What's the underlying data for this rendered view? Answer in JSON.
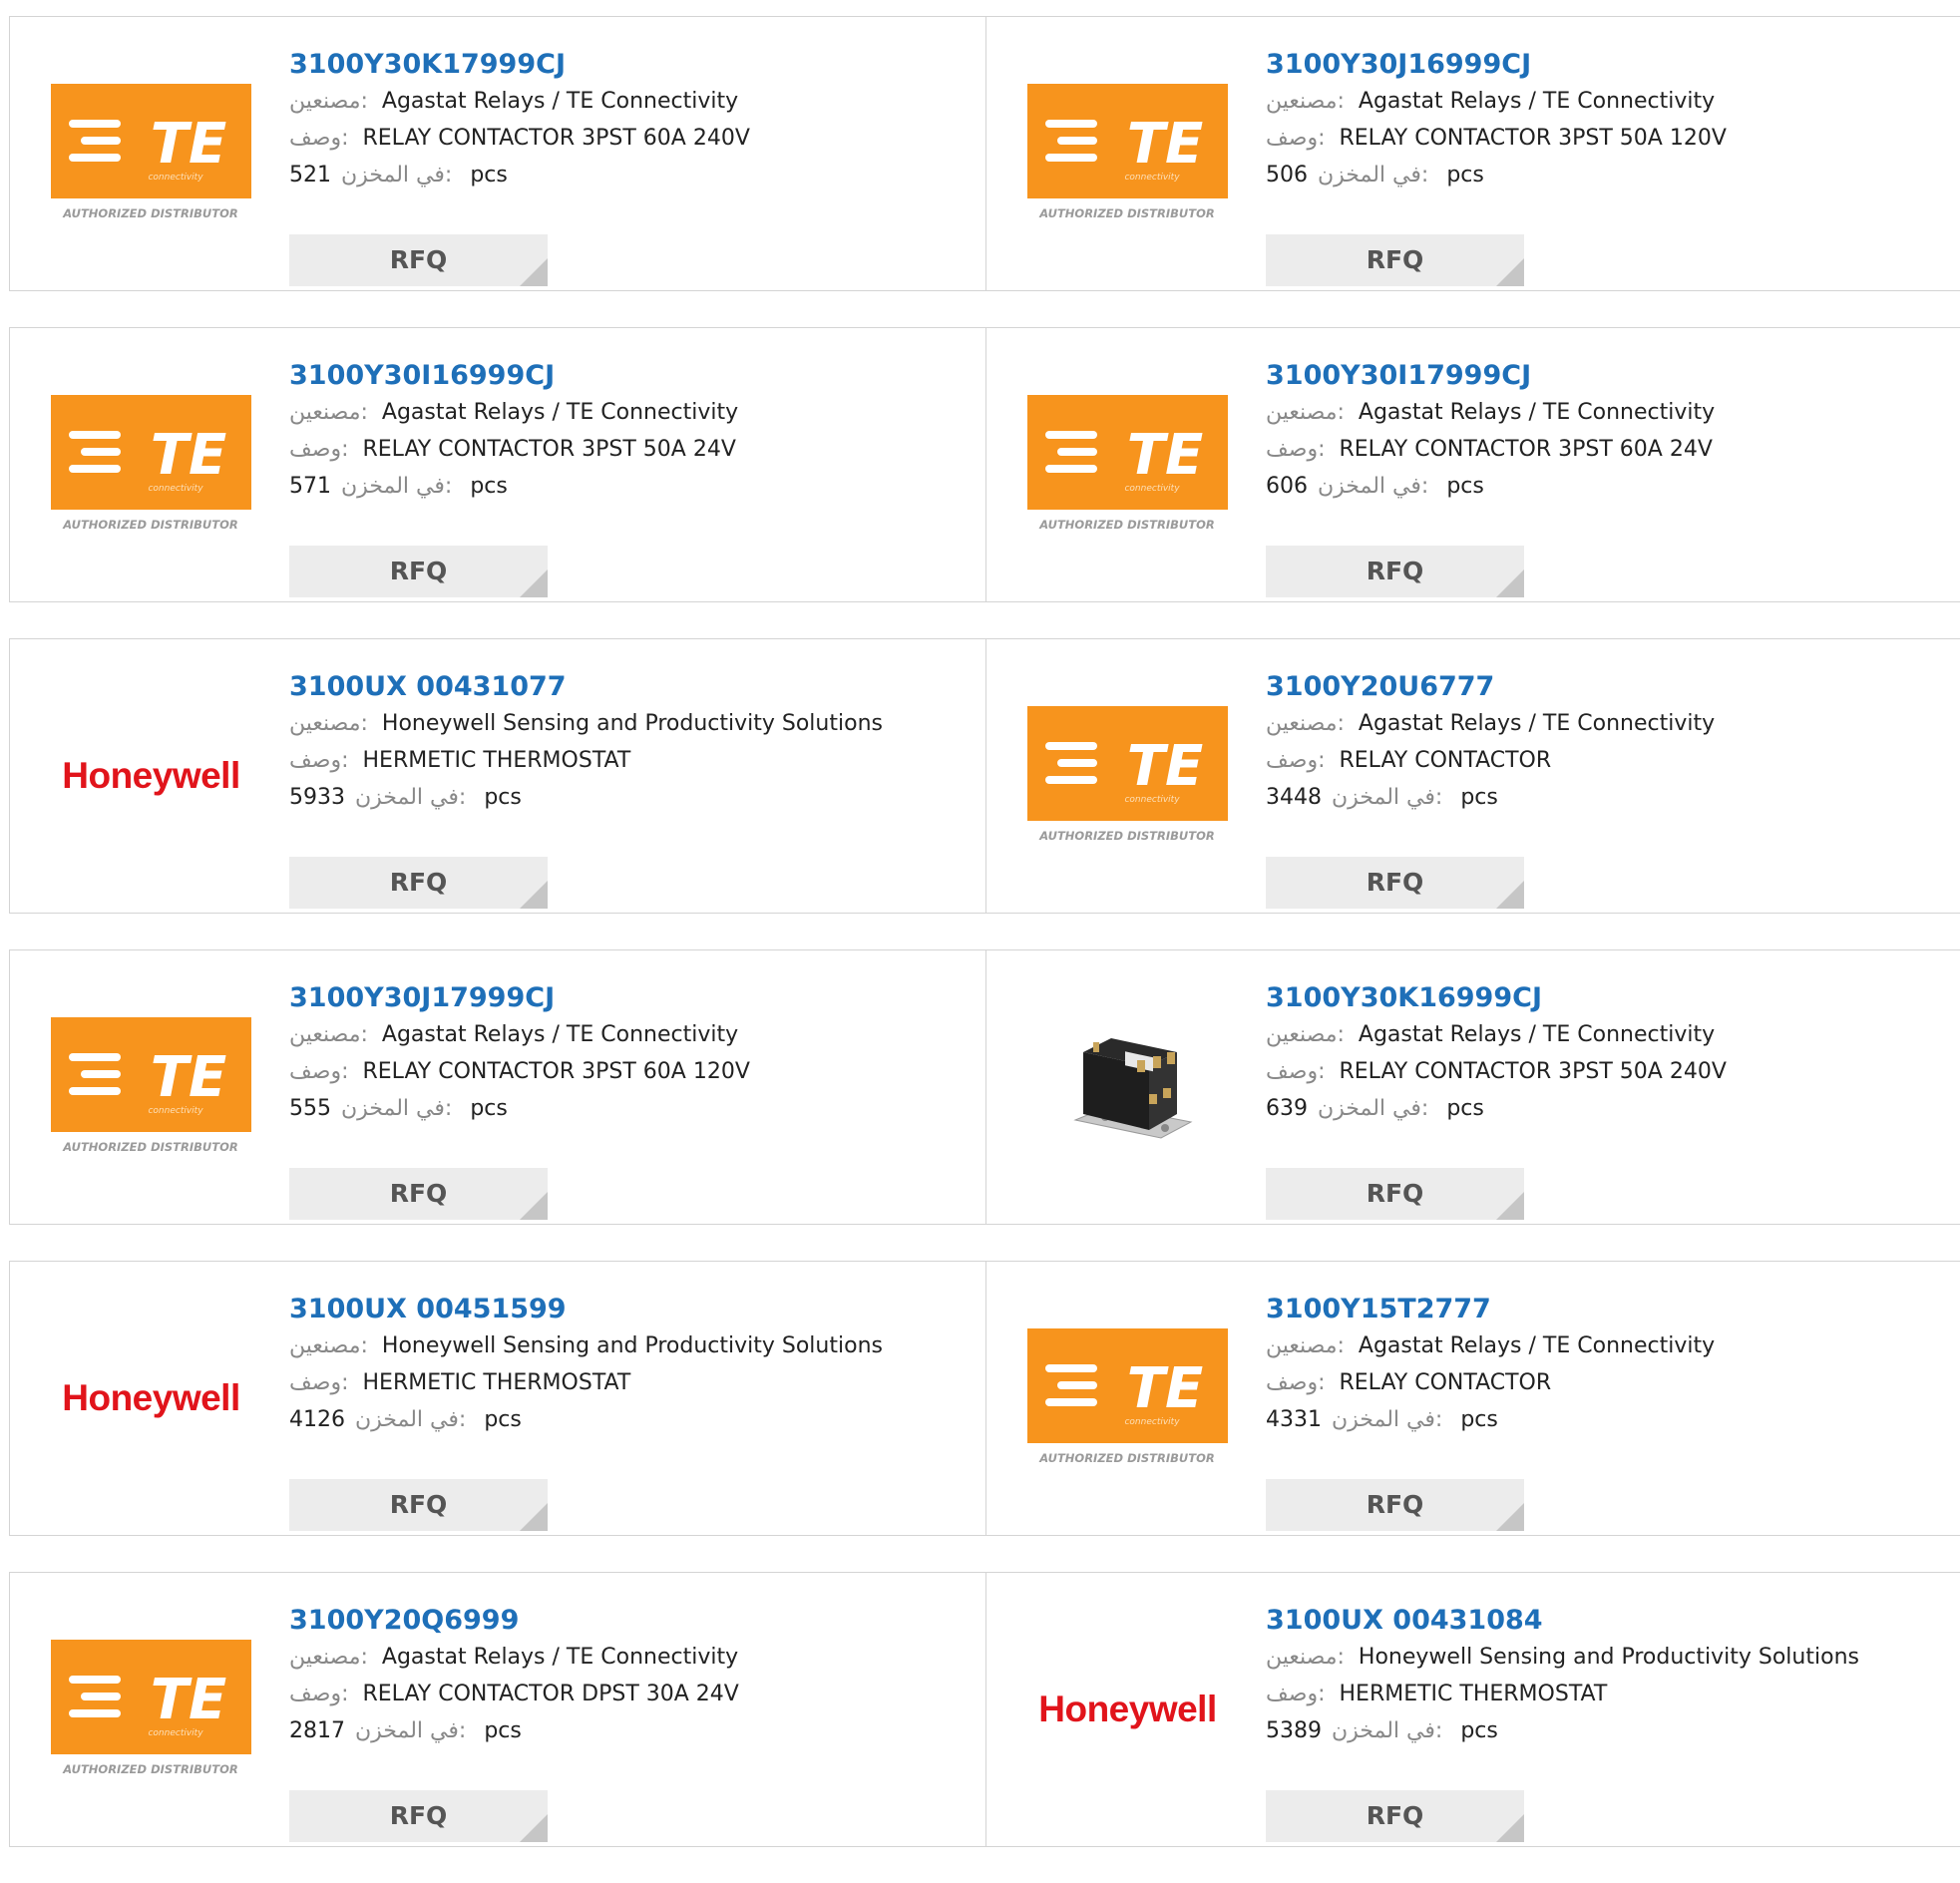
{
  "labels": {
    "manufacturer": "مصنعين",
    "description": "وصف",
    "stock": "في المخزن",
    "unit": "pcs",
    "rfq": "RFQ"
  },
  "logo_text": {
    "te_mark": "TE",
    "te_sub": "connectivity",
    "te_footer": "AUTHORIZED DISTRIBUTOR",
    "honeywell": "Honeywell"
  },
  "colors": {
    "link_blue": "#1e6fb8",
    "te_orange": "#f7941d",
    "honeywell_red": "#e1141b",
    "rfq_bg": "#ececec"
  },
  "products": [
    {
      "part": "3100Y30K17999CJ",
      "logo": "te",
      "manufacturer": "Agastat Relays / TE Connectivity",
      "description": "RELAY CONTACTOR 3PST 60A 240V",
      "stock": "521"
    },
    {
      "part": "3100Y30J16999CJ",
      "logo": "te",
      "manufacturer": "Agastat Relays / TE Connectivity",
      "description": "RELAY CONTACTOR 3PST 50A 120V",
      "stock": "506"
    },
    {
      "part": "3100Y30I16999CJ",
      "logo": "te",
      "manufacturer": "Agastat Relays / TE Connectivity",
      "description": "RELAY CONTACTOR 3PST 50A 24V",
      "stock": "571"
    },
    {
      "part": "3100Y30I17999CJ",
      "logo": "te",
      "manufacturer": "Agastat Relays / TE Connectivity",
      "description": "RELAY CONTACTOR 3PST 60A 24V",
      "stock": "606"
    },
    {
      "part": "3100UX 00431077",
      "logo": "honeywell",
      "manufacturer": "Honeywell Sensing and Productivity Solutions",
      "description": "HERMETIC THERMOSTAT",
      "stock": "5933"
    },
    {
      "part": "3100Y20U6777",
      "logo": "te",
      "manufacturer": "Agastat Relays / TE Connectivity",
      "description": "RELAY CONTACTOR",
      "stock": "3448"
    },
    {
      "part": "3100Y30J17999CJ",
      "logo": "te",
      "manufacturer": "Agastat Relays / TE Connectivity",
      "description": "RELAY CONTACTOR 3PST 60A 120V",
      "stock": "555"
    },
    {
      "part": "3100Y30K16999CJ",
      "logo": "photo",
      "manufacturer": "Agastat Relays / TE Connectivity",
      "description": "RELAY CONTACTOR 3PST 50A 240V",
      "stock": "639"
    },
    {
      "part": "3100UX 00451599",
      "logo": "honeywell",
      "manufacturer": "Honeywell Sensing and Productivity Solutions",
      "description": "HERMETIC THERMOSTAT",
      "stock": "4126"
    },
    {
      "part": "3100Y15T2777",
      "logo": "te",
      "manufacturer": "Agastat Relays / TE Connectivity",
      "description": "RELAY CONTACTOR",
      "stock": "4331"
    },
    {
      "part": "3100Y20Q6999",
      "logo": "te",
      "manufacturer": "Agastat Relays / TE Connectivity",
      "description": "RELAY CONTACTOR DPST 30A 24V",
      "stock": "2817"
    },
    {
      "part": "3100UX 00431084",
      "logo": "honeywell",
      "manufacturer": "Honeywell Sensing and Productivity Solutions",
      "description": "HERMETIC THERMOSTAT",
      "stock": "5389"
    }
  ]
}
